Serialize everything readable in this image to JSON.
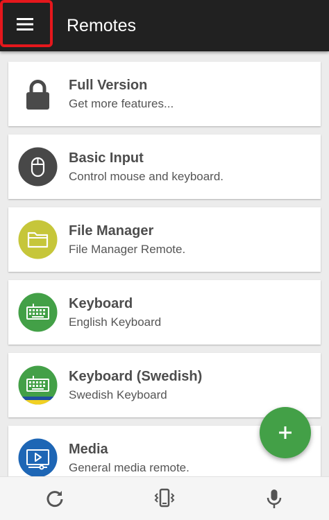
{
  "app": {
    "title": "Remotes"
  },
  "colors": {
    "appbar": "#212121",
    "highlight": "#e5171c",
    "fab": "#43a047",
    "mouse_icon_bg": "#484848",
    "file_icon_bg": "#c6c63a",
    "keyboard_icon_bg": "#43a047",
    "media_icon_bg": "#1e66b5"
  },
  "remotes": [
    {
      "title": "Full Version",
      "subtitle": "Get more features...",
      "icon": "lock-icon"
    },
    {
      "title": "Basic Input",
      "subtitle": "Control mouse and keyboard.",
      "icon": "mouse-icon"
    },
    {
      "title": "File Manager",
      "subtitle": "File Manager Remote.",
      "icon": "folder-icon"
    },
    {
      "title": "Keyboard",
      "subtitle": "English Keyboard",
      "icon": "keyboard-icon"
    },
    {
      "title": "Keyboard (Swedish)",
      "subtitle": "Swedish Keyboard",
      "icon": "keyboard-swedish-icon"
    },
    {
      "title": "Media",
      "subtitle": "General media remote.",
      "icon": "media-player-icon"
    }
  ],
  "fab": {
    "icon": "plus-icon"
  },
  "bottom_bar": [
    {
      "icon": "refresh-icon"
    },
    {
      "icon": "phone-vibrate-icon"
    },
    {
      "icon": "microphone-icon"
    }
  ]
}
